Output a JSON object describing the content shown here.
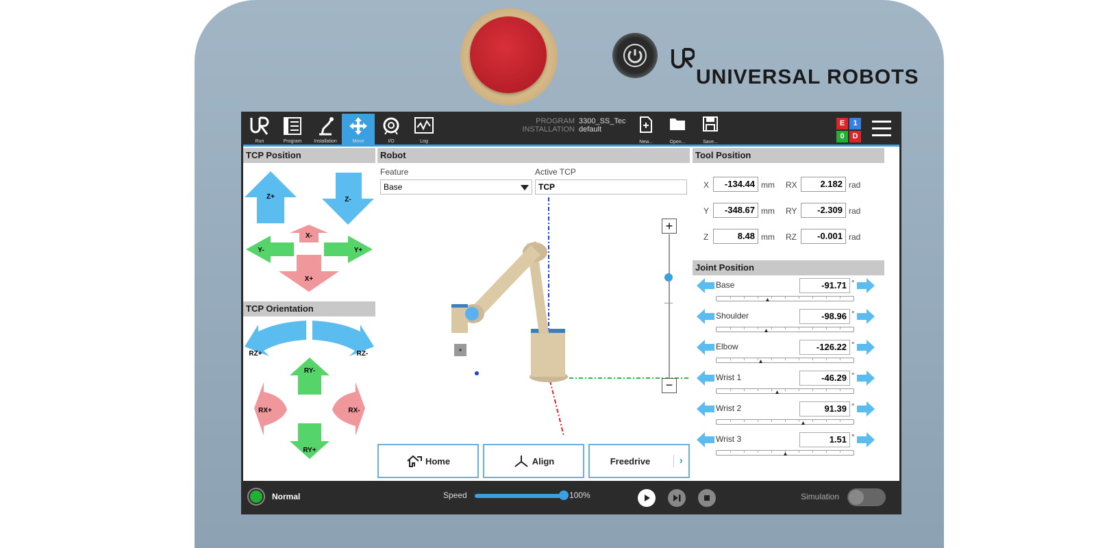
{
  "brand": {
    "name": "UNIVERSAL ROBOTS",
    "logo_text": "UR"
  },
  "nav_tabs": [
    {
      "label": "Run",
      "icon": "ur-logo-icon"
    },
    {
      "label": "Program",
      "icon": "program-icon"
    },
    {
      "label": "Installation",
      "icon": "installation-icon"
    },
    {
      "label": "Move",
      "icon": "move-icon",
      "active": true
    },
    {
      "label": "I/O",
      "icon": "io-icon"
    },
    {
      "label": "Log",
      "icon": "log-icon"
    }
  ],
  "program_info": {
    "program_label": "PROGRAM",
    "program_value": "3300_SS_Tec",
    "installation_label": "INSTALLATION",
    "installation_value": "default"
  },
  "toolbar": {
    "new_label": "New...",
    "open_label": "Open...",
    "save_label": "Save..."
  },
  "status_grid": {
    "e": "E",
    "one": "1",
    "zero": "0",
    "d": "D"
  },
  "tcp_position": {
    "title": "TCP Position",
    "buttons": {
      "z_plus": "Z+",
      "z_minus": "Z-",
      "x_minus": "X-",
      "x_plus": "X+",
      "y_minus": "Y-",
      "y_plus": "Y+"
    }
  },
  "tcp_orientation": {
    "title": "TCP Orientation",
    "buttons": {
      "rz_plus": "RZ+",
      "rz_minus": "RZ-",
      "ry_minus": "RY-",
      "ry_plus": "RY+",
      "rx_plus": "RX+",
      "rx_minus": "RX-"
    }
  },
  "robot": {
    "title": "Robot",
    "feature_label": "Feature",
    "feature_value": "Base",
    "active_tcp_label": "Active TCP",
    "active_tcp_value": "TCP",
    "zoom_in": "+",
    "zoom_out": "−",
    "home_label": "Home",
    "align_label": "Align",
    "freedrive_label": "Freedrive",
    "freedrive_chevron": "›"
  },
  "tool_position": {
    "title": "Tool Position",
    "rows": [
      {
        "axis": "X",
        "value": "-134.44",
        "unit": "mm",
        "raxis": "RX",
        "rvalue": "2.182",
        "runit": "rad"
      },
      {
        "axis": "Y",
        "value": "-348.67",
        "unit": "mm",
        "raxis": "RY",
        "rvalue": "-2.309",
        "runit": "rad"
      },
      {
        "axis": "Z",
        "value": "8.48",
        "unit": "mm",
        "raxis": "RZ",
        "rvalue": "-0.001",
        "runit": "rad"
      }
    ]
  },
  "joint_position": {
    "title": "Joint Position",
    "degree_symbol": "°",
    "joints": [
      {
        "name": "Base",
        "value": "-91.71",
        "fraction": 0.37
      },
      {
        "name": "Shoulder",
        "value": "-98.96",
        "fraction": 0.36
      },
      {
        "name": "Elbow",
        "value": "-126.22",
        "fraction": 0.32
      },
      {
        "name": "Wrist 1",
        "value": "-46.29",
        "fraction": 0.44
      },
      {
        "name": "Wrist 2",
        "value": "91.39",
        "fraction": 0.63
      },
      {
        "name": "Wrist 3",
        "value": "1.51",
        "fraction": 0.5
      }
    ]
  },
  "bottom_bar": {
    "status_label": "Normal",
    "speed_label": "Speed",
    "speed_value": "100%",
    "speed_fraction": 1.0,
    "simulation_label": "Simulation"
  },
  "colors": {
    "accent": "#3aa0e0",
    "arrow_blue": "#5bbcf0",
    "arrow_green": "#55d46a",
    "arrow_red": "#f0979c",
    "status_green": "#22b033"
  }
}
